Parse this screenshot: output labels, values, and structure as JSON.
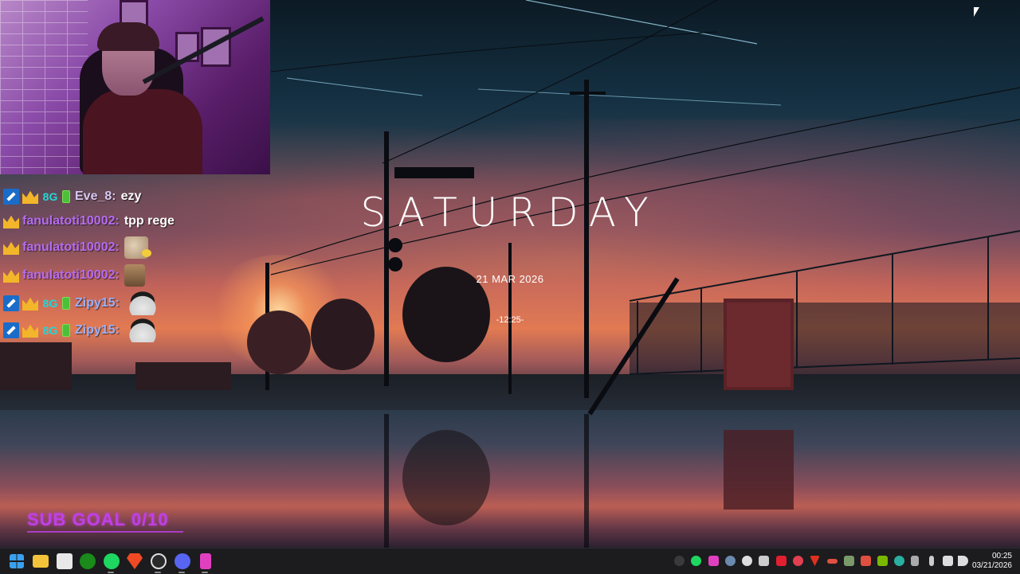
{
  "widget": {
    "day": "SATURDAY",
    "date": "21 MAR 2026",
    "time": "-12:25-"
  },
  "chat": {
    "messages": [
      {
        "user": "Eve_8:",
        "user_color": "#d8c8f0",
        "badges": [
          "hammer",
          "crown",
          "8g",
          "battery"
        ],
        "text": "ezy",
        "emote": null
      },
      {
        "user": "fanulatoti10002:",
        "user_color": "#b56cf0",
        "badges": [
          "crown"
        ],
        "text": "tpp rege",
        "emote": null
      },
      {
        "user": "fanulatoti10002:",
        "user_color": "#b56cf0",
        "badges": [
          "crown"
        ],
        "text": "",
        "emote": "cat-emote"
      },
      {
        "user": "fanulatoti10002:",
        "user_color": "#b56cf0",
        "badges": [
          "crown"
        ],
        "text": "",
        "emote": "dog-emote"
      },
      {
        "user": "Zipy15:",
        "user_color": "#9ab0f8",
        "badges": [
          "hammer",
          "crown",
          "8g",
          "battery"
        ],
        "text": "",
        "emote": "blob-emote"
      },
      {
        "user": "Zipy15:",
        "user_color": "#9ab0f8",
        "badges": [
          "hammer",
          "crown",
          "8g",
          "battery"
        ],
        "text": "",
        "emote": "blob-emote"
      }
    ],
    "badge_8g": "8G"
  },
  "overlay": {
    "sub_goal": "SUB GOAL 0/10",
    "sub_goal_color": "#c040e8"
  },
  "taskbar": {
    "pinned": [
      "windows-start-icon",
      "file-explorer-icon",
      "microsoft-store-icon",
      "xbox-icon",
      "spotify-icon",
      "brave-browser-icon",
      "obs-icon",
      "discord-icon",
      "streamlabs-icon"
    ],
    "tray": [
      "spotify-tray-icon",
      "streamlabs-tray-icon",
      "steam-tray-icon",
      "obs-tray-icon",
      "app-tray-icon",
      "roblox-tray-icon",
      "antivirus-tray-icon",
      "download-tray-icon",
      "battery-tray-icon",
      "display-tray-icon",
      "nvidia-tray-icon",
      "edge-tray-icon",
      "shield-tray-icon",
      "pen-tray-icon",
      "app2-tray-icon",
      "network-tray-icon",
      "wifi-tray-icon",
      "microphone-tray-icon",
      "volume-tray-icon"
    ],
    "clock_time": "00:25",
    "clock_date": "03/21/2026"
  }
}
